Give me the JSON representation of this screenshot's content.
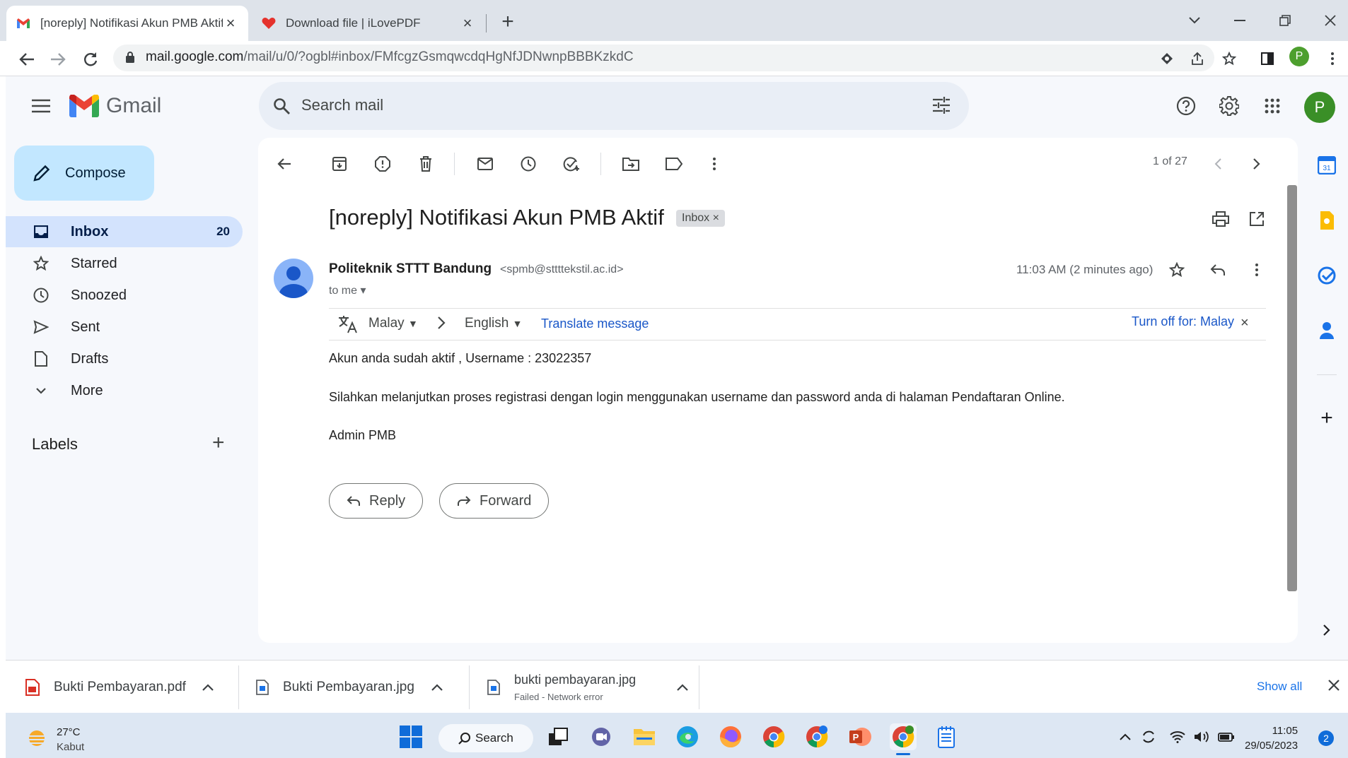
{
  "browser": {
    "tabs": [
      {
        "title": "[noreply] Notifikasi Akun PMB Aktif",
        "icon": "gmail-icon"
      },
      {
        "title": "Download file | iLovePDF",
        "icon": "ilovepdf-icon"
      }
    ],
    "new_tab": "+",
    "url_host": "mail.google.com",
    "url_path": "/mail/u/0/?ogbl#inbox/FMfcgzGsmqwcdqHgNfJDNwnpBBBKzkdC",
    "profile_initial": "P"
  },
  "gmail": {
    "logo_text": "Gmail",
    "search_placeholder": "Search mail",
    "avatar_initial": "P",
    "compose_label": "Compose",
    "nav": [
      {
        "label": "Inbox",
        "count": "20"
      },
      {
        "label": "Starred"
      },
      {
        "label": "Snoozed"
      },
      {
        "label": "Sent"
      },
      {
        "label": "Drafts"
      },
      {
        "label": "More"
      }
    ],
    "labels_title": "Labels",
    "pager": "1 of 27",
    "message": {
      "subject": "[noreply] Notifikasi Akun PMB Aktif",
      "badge": "Inbox",
      "sender_name": "Politeknik STTT Bandung",
      "sender_email": "<spmb@sttttekstil.ac.id>",
      "to": "to me",
      "time": "11:03 AM (2 minutes ago)",
      "translate": {
        "from": "Malay",
        "to": "English",
        "action": "Translate message",
        "turn_off": "Turn off for: Malay"
      },
      "body": [
        "Akun anda sudah aktif , Username : 23022357",
        "Silahkan melanjutkan proses registrasi dengan login menggunakan username dan password anda di halaman Pendaftaran Online.",
        "Admin PMB"
      ],
      "reply_label": "Reply",
      "forward_label": "Forward"
    }
  },
  "downloads": {
    "items": [
      {
        "name": "Bukti Pembayaran.pdf"
      },
      {
        "name": "Bukti Pembayaran.jpg"
      },
      {
        "name": "bukti pembayaran.jpg",
        "status": "Failed - Network error"
      }
    ],
    "show_all": "Show all"
  },
  "taskbar": {
    "weather_temp": "27°C",
    "weather_desc": "Kabut",
    "search_label": "Search",
    "time": "11:05",
    "date": "29/05/2023",
    "notification_count": "2"
  },
  "colors": {
    "accent": "#0b57d0",
    "compose_bg": "#c2e7ff",
    "inbox_selected": "#d3e3fd"
  }
}
